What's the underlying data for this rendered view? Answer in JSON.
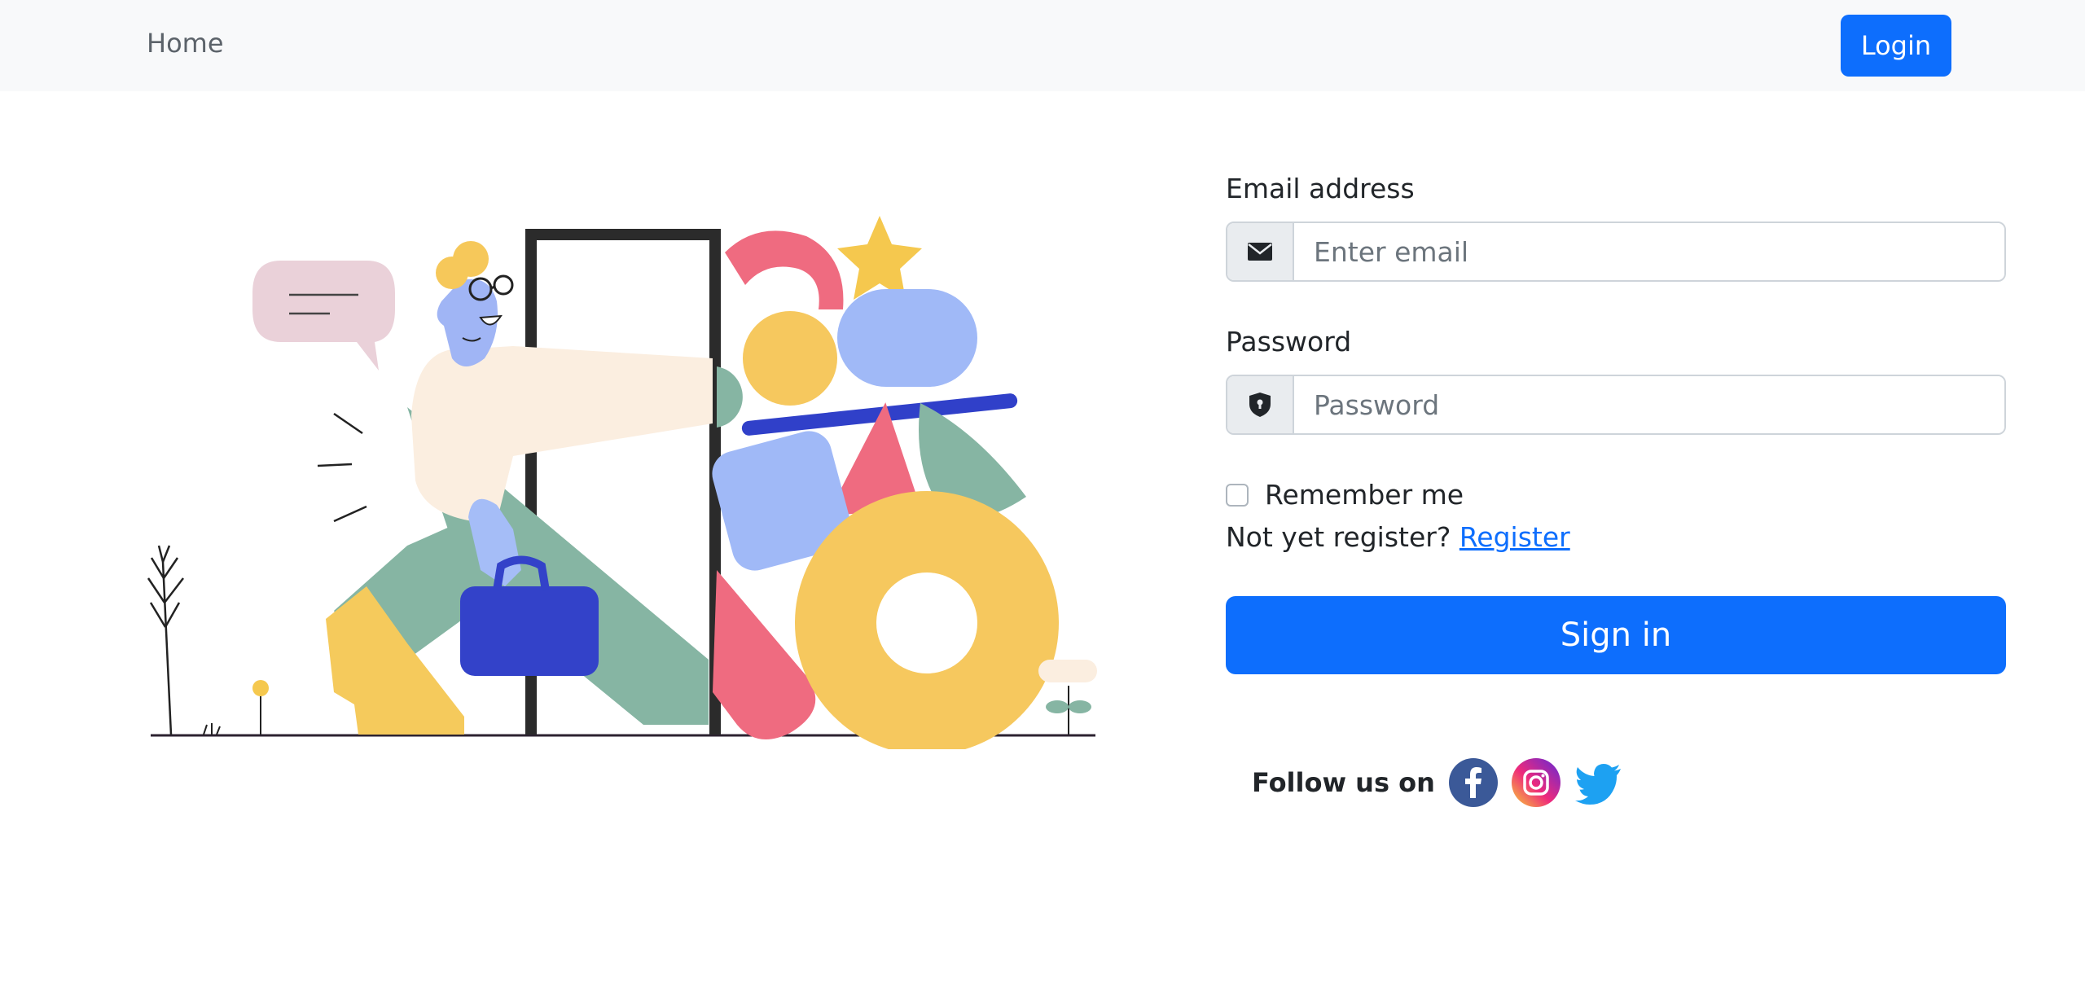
{
  "nav": {
    "home_label": "Home",
    "login_label": "Login"
  },
  "form": {
    "email_label": "Email address",
    "email_placeholder": "Enter email",
    "email_icon": "envelope-icon",
    "password_label": "Password",
    "password_placeholder": "Password",
    "password_icon": "shield-lock-icon",
    "remember_label": "Remember me",
    "remember_checked": false,
    "register_prompt": "Not yet register?",
    "register_link": "Register",
    "signin_label": "Sign in"
  },
  "social": {
    "follow_label": "Follow us on",
    "icons": [
      "facebook-icon",
      "instagram-icon",
      "twitter-icon"
    ]
  },
  "colors": {
    "primary": "#0d6efd",
    "navbar_bg": "#f8f9fa"
  }
}
